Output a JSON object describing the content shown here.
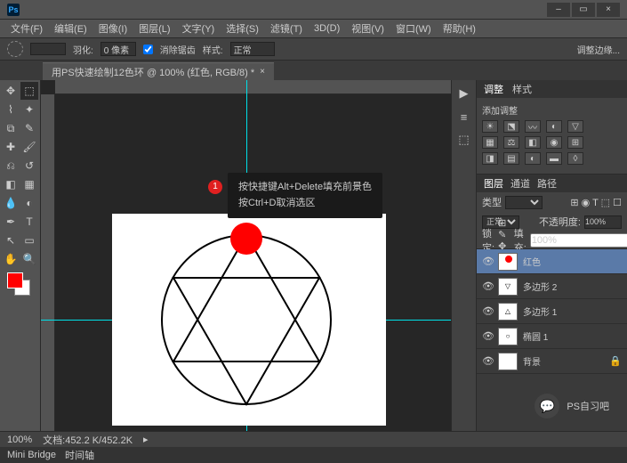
{
  "menus": [
    "文件(F)",
    "编辑(E)",
    "图像(I)",
    "图层(L)",
    "文字(Y)",
    "选择(S)",
    "滤镜(T)",
    "3D(D)",
    "视图(V)",
    "窗口(W)",
    "帮助(H)"
  ],
  "options": {
    "feather_label": "羽化:",
    "feather_value": "0 像素",
    "antialias": "消除锯齿",
    "style_label": "样式:",
    "style_value": "正常",
    "adjust": "调整边缘..."
  },
  "doc_tab": "用PS快速绘制12色环 @ 100% (红色, RGB/8) *",
  "tooltip": {
    "num": "1",
    "line1": "按快捷键Alt+Delete填充前景色",
    "line2": "按Ctrl+D取消选区"
  },
  "adjustments": {
    "tab": "调整",
    "tab2": "样式",
    "title": "添加调整"
  },
  "layers_panel": {
    "tabs": [
      "图层",
      "通道",
      "路径"
    ],
    "kind": "类型",
    "blend": "正常",
    "opacity_label": "不透明度:",
    "opacity": "100%",
    "lock_label": "锁定:",
    "fill_label": "填充:",
    "fill": "100%",
    "layers": [
      {
        "name": "红色",
        "sel": true
      },
      {
        "name": "多边形 2",
        "sel": false
      },
      {
        "name": "多边形 1",
        "sel": false
      },
      {
        "name": "椭圆 1",
        "sel": false
      },
      {
        "name": "背景",
        "sel": false
      }
    ]
  },
  "status": {
    "zoom": "100%",
    "docinfo": "文档:452.2 K/452.2K"
  },
  "bottom_tabs": [
    "Mini Bridge",
    "时间轴"
  ],
  "watermark": "PS自习吧"
}
